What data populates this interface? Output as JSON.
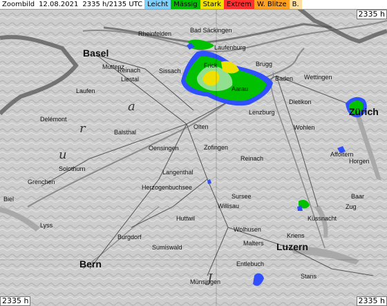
{
  "header": {
    "title": "Zoombild",
    "date": "12.08.2021",
    "time_info": "2335 h/2135 UTC",
    "legend": [
      {
        "label": "Leicht",
        "color": "#7fd0ff"
      },
      {
        "label": "Mässig",
        "color": "#00c000"
      },
      {
        "label": "Stark",
        "color": "#f0e000"
      },
      {
        "label": "Extrem",
        "color": "#ff3030"
      },
      {
        "label": "W. Blitze",
        "color": "#ffa020"
      },
      {
        "label": "B.",
        "color": "#ffe0a0"
      }
    ],
    "corner_time": "2335 h"
  },
  "footer": {
    "left_time": "2335 h",
    "right_time": "2335 h"
  },
  "map": {
    "cities": [
      {
        "name": "Basel",
        "big": true
      },
      {
        "name": "Zürich",
        "big": true
      },
      {
        "name": "Bern",
        "big": true
      },
      {
        "name": "Luzern",
        "big": true
      },
      {
        "name": "Olten",
        "big": false
      },
      {
        "name": "Aarau",
        "big": false
      },
      {
        "name": "Baden",
        "big": false
      },
      {
        "name": "Brugg",
        "big": false
      },
      {
        "name": "Solothurn",
        "big": false
      },
      {
        "name": "Delémont",
        "big": false
      },
      {
        "name": "Biel",
        "big": false
      },
      {
        "name": "Zofingen",
        "big": false
      },
      {
        "name": "Langenthal",
        "big": false
      },
      {
        "name": "Burgdorf",
        "big": false
      },
      {
        "name": "Wettingen",
        "big": false
      },
      {
        "name": "Rheinfelden",
        "big": false
      },
      {
        "name": "Liestal",
        "big": false
      },
      {
        "name": "Sissach",
        "big": false
      },
      {
        "name": "Frick",
        "big": false
      },
      {
        "name": "Laufenburg",
        "big": false
      },
      {
        "name": "Bad Säckingen",
        "big": false
      },
      {
        "name": "Lenzburg",
        "big": false
      },
      {
        "name": "Dietikon",
        "big": false
      },
      {
        "name": "Wohlen",
        "big": false
      },
      {
        "name": "Reinach",
        "big": false
      },
      {
        "name": "Sursee",
        "big": false
      },
      {
        "name": "Willisau",
        "big": false
      },
      {
        "name": "Huttwil",
        "big": false
      },
      {
        "name": "Sumiswald",
        "big": false
      },
      {
        "name": "Entlebuch",
        "big": false
      },
      {
        "name": "Wolhusen",
        "big": false
      },
      {
        "name": "Malters",
        "big": false
      },
      {
        "name": "Kriens",
        "big": false
      },
      {
        "name": "Küssnacht",
        "big": false
      },
      {
        "name": "Horgen",
        "big": false
      },
      {
        "name": "Affoltern",
        "big": false
      },
      {
        "name": "Baar",
        "big": false
      },
      {
        "name": "Zug",
        "big": false
      },
      {
        "name": "Stans",
        "big": false
      },
      {
        "name": "Lyss",
        "big": false
      },
      {
        "name": "Grenchen",
        "big": false
      },
      {
        "name": "Balsthal",
        "big": false
      },
      {
        "name": "Oensingen",
        "big": false
      },
      {
        "name": "Laufen",
        "big": false
      },
      {
        "name": "Reinach",
        "big": false
      },
      {
        "name": "Muttenz",
        "big": false
      },
      {
        "name": "Herzogenbuchsee",
        "big": false
      },
      {
        "name": "Münsingen",
        "big": false
      }
    ],
    "regions": [
      "a",
      "r",
      "u",
      "J"
    ],
    "colors": {
      "light": "#7fd0ff",
      "moderate": "#00c000",
      "strong": "#f0e000",
      "blue": "#3050ff"
    }
  }
}
